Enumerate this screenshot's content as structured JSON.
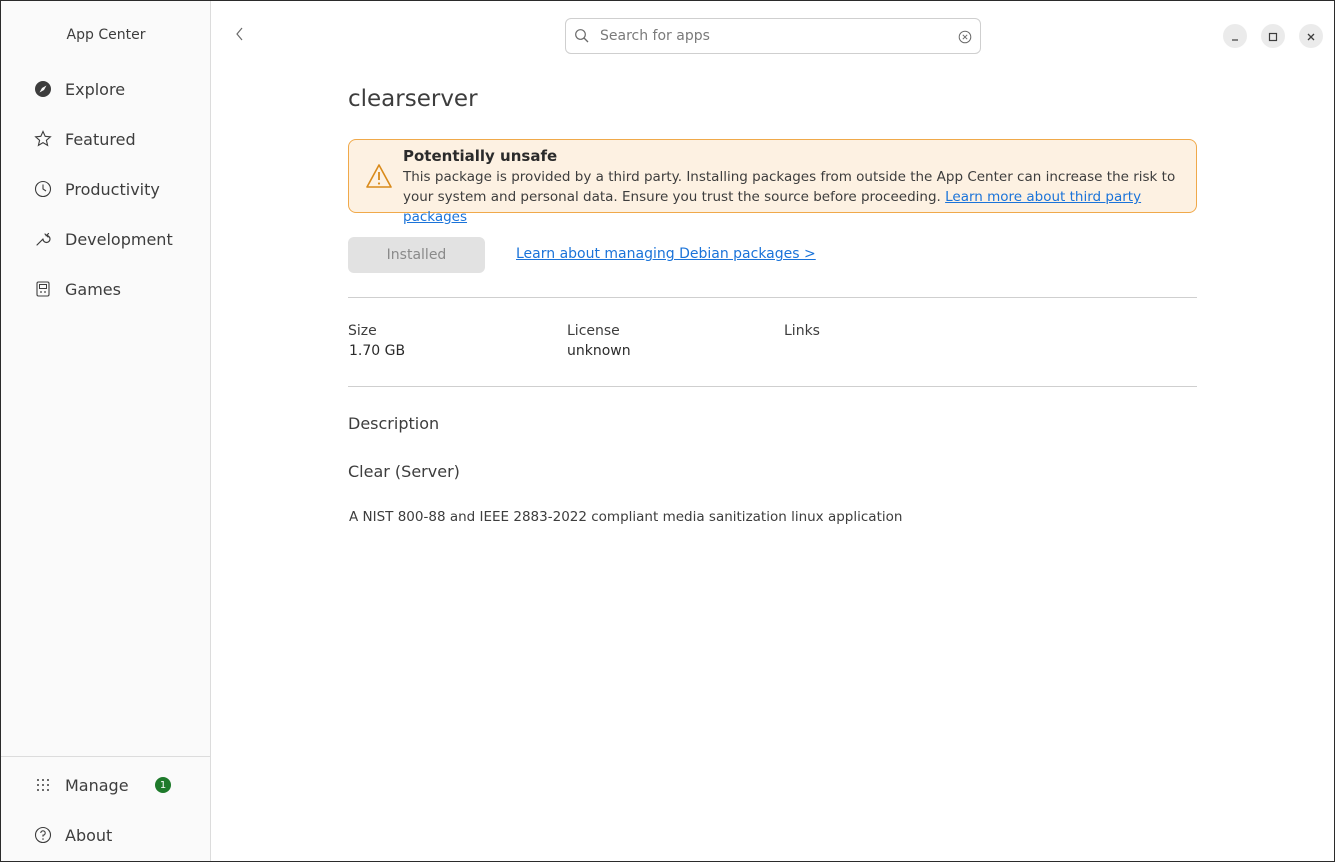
{
  "window": {
    "title": "App Center"
  },
  "sidebar": {
    "items": [
      {
        "label": "Explore",
        "icon": "compass-icon"
      },
      {
        "label": "Featured",
        "icon": "star-icon"
      },
      {
        "label": "Productivity",
        "icon": "clock-icon"
      },
      {
        "label": "Development",
        "icon": "wrench-icon"
      },
      {
        "label": "Games",
        "icon": "gamepad-icon"
      }
    ],
    "bottom_items": [
      {
        "label": "Manage",
        "icon": "grid-icon",
        "badge": "1"
      },
      {
        "label": "About",
        "icon": "help-icon"
      }
    ]
  },
  "search": {
    "placeholder": "Search for apps",
    "value": ""
  },
  "app": {
    "name": "clearserver",
    "warning": {
      "title": "Potentially unsafe",
      "text": "This package is provided by a third party. Installing packages from outside the App Center can increase the risk to your system and personal data. Ensure you trust the source before proceeding.",
      "link": "Learn more about third party packages"
    },
    "install_button": "Installed",
    "manage_link": "Learn about managing Debian packages >",
    "meta": {
      "size_label": "Size",
      "size_value": "1.70 GB",
      "license_label": "License",
      "license_value": "unknown",
      "links_label": "Links"
    },
    "description": {
      "heading": "Description",
      "summary": "Clear (Server)",
      "body": "A NIST 800-88 and IEEE 2883-2022 compliant media sanitization linux application"
    }
  },
  "colors": {
    "warning_border": "#f0a94a",
    "warning_bg": "#fdf1e2",
    "link": "#1a73d9",
    "badge": "#1e7a2b"
  }
}
